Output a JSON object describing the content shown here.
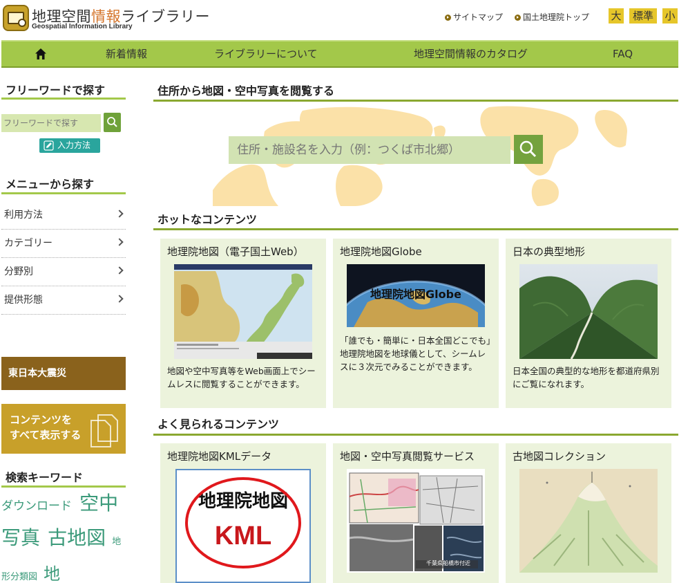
{
  "header": {
    "title_part1": "地理空間",
    "title_part2": "情報",
    "title_part3": "ライブラリー",
    "subtitle": "Geospatial Information Library",
    "links": [
      "サイトマップ",
      "国土地理院トップ"
    ],
    "font_sizes": [
      "大",
      "標準",
      "小"
    ]
  },
  "nav": {
    "home_icon": "home-icon",
    "items": [
      "新着情報",
      "ライブラリーについて",
      "地理空間情報のカタログ",
      "FAQ"
    ]
  },
  "sidebar": {
    "freeword": {
      "heading": "フリーワードで探す",
      "placeholder": "フリーワードで探す",
      "howto_label": "入力方法"
    },
    "menu": {
      "heading": "メニューから探す",
      "items": [
        "利用方法",
        "カテゴリー",
        "分野別",
        "提供形態"
      ]
    },
    "banners": [
      "東日本大震災",
      "コンテンツを",
      "すべて表示する"
    ],
    "keywords": {
      "heading": "検索キーワード",
      "items": [
        "ダウンロード",
        "空中写真",
        "古地図",
        "地形分類図",
        "地"
      ]
    }
  },
  "main": {
    "map_search": {
      "heading": "住所から地図・空中写真を閲覧する",
      "placeholder": "住所・施設名を入力（例：つくば市北郷）"
    },
    "hot": {
      "heading": "ホットなコンテンツ",
      "cards": [
        {
          "title": "地理院地図（電子国土Web）",
          "desc": "地図や空中写真等をWeb画面上でシームレスに閲覧することができます。"
        },
        {
          "title": "地理院地図Globe",
          "img_text": "地理院地図Globe",
          "desc": "「誰でも・簡単に・日本全国どこでも」地理院地図を地球儀として、シームレスに３次元でみることができます。"
        },
        {
          "title": "日本の典型地形",
          "desc": "日本全国の典型的な地形を都道府県別にご覧になれます。"
        }
      ]
    },
    "popular": {
      "heading": "よく見られるコンテンツ",
      "cards": [
        {
          "title": "地理院地図KMLデータ",
          "img_line1": "地理院地図",
          "img_line2": "KML"
        },
        {
          "title": "地図・空中写真閲覧サービス",
          "img_caption": "千葉県船橋市付近"
        },
        {
          "title": "古地図コレクション"
        }
      ]
    }
  }
}
